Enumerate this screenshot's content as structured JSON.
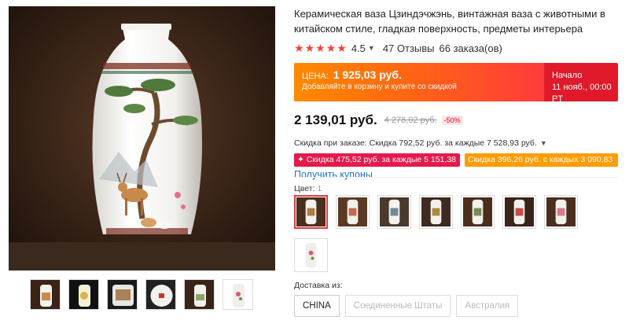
{
  "product": {
    "title": "Керамическая ваза Цзиндэчжэнь, винтажная ваза с животными в китайском стиле, гладкая поверхность, предметы интерьера",
    "rating": "4.5",
    "reviews": "47 Отзывы",
    "orders": "66 заказа(ов)"
  },
  "promo": {
    "price_label": "ЦЕНА:",
    "price": "1 925,03 руб.",
    "subtitle": "Добавляйте в корзину и купите со скидкой",
    "start_label": "Начало",
    "start_time": "11 нояб., 00:00 PT"
  },
  "price": {
    "current": "2 139,01 руб.",
    "original": "4 278,02 руб.",
    "discount": "-50%"
  },
  "discounts": {
    "store_line": "Скидка при заказе: Скидка 792,52 руб. за каждые 7 528,93 руб.",
    "tag1": "✦ Скидка 475,52 руб. за каждые 5 151,38 руб.",
    "tag2": "Скидка 396,26 руб. с каждых 3 090,83 руб.",
    "coupon_link": "Получить купоны"
  },
  "color": {
    "label": "Цвет:",
    "count": "1",
    "selected_index": 0,
    "swatches": [
      "Вариант 1",
      "Вариант 2",
      "Вариант 3",
      "Вариант 4",
      "Вариант 5",
      "Вариант 6",
      "Вариант 7",
      "Вариант 8"
    ]
  },
  "delivery": {
    "label": "Доставка из:",
    "options": [
      "CHINA",
      "Соединенные Штаты",
      "Австралия"
    ],
    "selected": "CHINA"
  },
  "colors": {
    "accent_red": "#e4393c",
    "star_red": "#f44336",
    "link_blue": "#1a73c9",
    "promo_orange": "#ff8a00",
    "tag_pink": "#e6194b",
    "tag_orange": "#ff9c00"
  },
  "icons": {
    "star": "star-icon",
    "chevron": "chevron-down-icon"
  }
}
